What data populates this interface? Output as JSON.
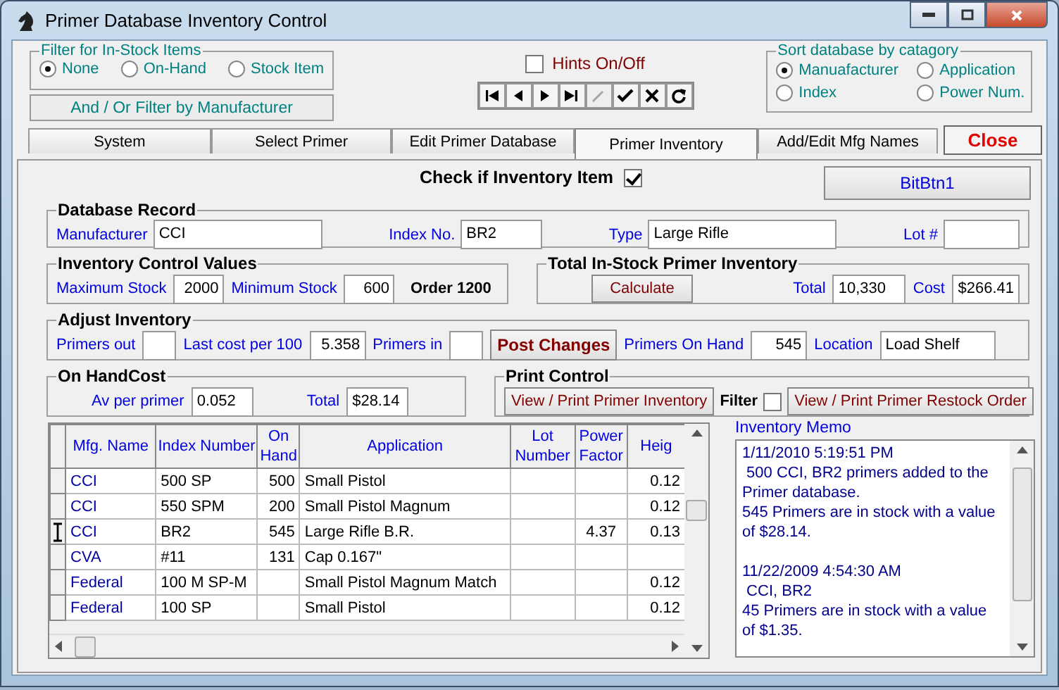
{
  "window": {
    "title": "Primer Database Inventory Control"
  },
  "filter_group": {
    "title": "Filter for In-Stock Items",
    "options": [
      {
        "label": "None",
        "selected": true
      },
      {
        "label": "On-Hand",
        "selected": false
      },
      {
        "label": "Stock Item",
        "selected": false
      }
    ],
    "button": "And / Or Filter by Manufacturer"
  },
  "hints": {
    "label": "Hints On/Off",
    "checked": false
  },
  "nav_buttons": [
    {
      "kind": "first",
      "disabled": false
    },
    {
      "kind": "prior",
      "disabled": false
    },
    {
      "kind": "next",
      "disabled": false
    },
    {
      "kind": "last",
      "disabled": false
    },
    {
      "kind": "edit",
      "disabled": true
    },
    {
      "kind": "post",
      "disabled": false
    },
    {
      "kind": "cancel",
      "disabled": false
    },
    {
      "kind": "refresh",
      "disabled": false
    }
  ],
  "sort_group": {
    "title": "Sort database by catagory",
    "options": [
      {
        "label": "Manuafacturer",
        "selected": true
      },
      {
        "label": "Application",
        "selected": false
      },
      {
        "label": "Index",
        "selected": false
      },
      {
        "label": "Power Num.",
        "selected": false
      }
    ]
  },
  "tabs": [
    {
      "label": "System",
      "selected": false
    },
    {
      "label": "Select Primer",
      "selected": false
    },
    {
      "label": "Edit Primer Database",
      "selected": false
    },
    {
      "label": "Primer Inventory",
      "selected": true
    },
    {
      "label": "Add/Edit Mfg Names",
      "selected": false
    }
  ],
  "close_button": "Close",
  "inventory_check": {
    "label": "Check if Inventory Item",
    "checked": true
  },
  "bit_button": "BitBtn1",
  "database_record": {
    "title": "Database Record",
    "fields": [
      {
        "label": "Manufacturer",
        "value": "CCI"
      },
      {
        "label": "Index No.",
        "value": "BR2"
      },
      {
        "label": "Type",
        "value": "Large Rifle"
      },
      {
        "label": "Lot #"
      }
    ]
  },
  "inventory_control": {
    "title": "Inventory Control Values",
    "max_label": "Maximum Stock",
    "max_value": "2000",
    "min_label": "Minimum Stock",
    "min_value": "600",
    "order": "Order 1200"
  },
  "total_stock": {
    "title": "Total  In-Stock Primer Inventory",
    "calculate": "Calculate",
    "total_label": "Total",
    "total": "10,330",
    "cost_label": "Cost",
    "cost": "$266.41"
  },
  "adjust": {
    "title": "Adjust Inventory",
    "primers_out_label": "Primers out",
    "last_cost_label": "Last cost per 100",
    "last_cost": "5.358",
    "primers_in_label": "Primers in",
    "post_button": "Post Changes",
    "on_hand_label": "Primers On Hand",
    "on_hand": "545",
    "location_label": "Location",
    "location": "Load Shelf"
  },
  "on_hand_cost": {
    "title": "On HandCost",
    "av_label": "Av per primer",
    "av": "0.052",
    "total_label": "Total",
    "total": "$28.14"
  },
  "print_control": {
    "title": "Print Control",
    "view_button": "View / Print Primer Inventory",
    "filter_label": "Filter",
    "filter_checked": false,
    "restock_button": "View / Print Primer Restock Order"
  },
  "table": {
    "columns": [
      "Mfg. Name",
      "Index Number",
      "On Hand",
      "Application",
      "Lot Number",
      "Power Factor",
      "Heig"
    ],
    "rows": [
      {
        "current": false,
        "cells": [
          "CCI",
          "500 SP",
          "500",
          "Small Pistol",
          "",
          "",
          "0.12"
        ]
      },
      {
        "current": false,
        "cells": [
          "CCI",
          "550 SPM",
          "200",
          "Small Pistol Magnum",
          "",
          "",
          "0.12"
        ]
      },
      {
        "current": true,
        "cells": [
          "CCI",
          "BR2",
          "545",
          "Large Rifle B.R.",
          "",
          "4.37",
          "0.13"
        ]
      },
      {
        "current": false,
        "cells": [
          "CVA",
          "#11",
          "131",
          "Cap 0.167\"",
          "",
          "",
          ""
        ]
      },
      {
        "current": false,
        "cells": [
          "Federal",
          "100 M SP-M",
          "",
          "Small Pistol Magnum Match",
          "",
          "",
          "0.12"
        ]
      },
      {
        "current": false,
        "cells": [
          "Federal",
          "100 SP",
          "",
          "Small Pistol",
          "",
          "",
          "0.12"
        ]
      }
    ]
  },
  "memo": {
    "label": "Inventory Memo",
    "entries": [
      {
        "lines": [
          "1/11/2010 5:19:51 PM",
          " 500 CCI, BR2 primers added to the",
          "Primer database.",
          "545 Primers are in stock with a value",
          "of $28.14."
        ]
      },
      {
        "lines": [
          "11/22/2009 4:54:30 AM",
          " CCI, BR2",
          "45 Primers are in stock with a value",
          "of $1.35."
        ]
      }
    ]
  }
}
